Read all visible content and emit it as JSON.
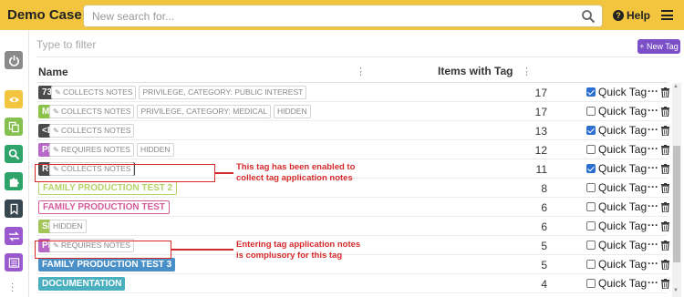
{
  "app": {
    "title": "Demo Case"
  },
  "search": {
    "placeholder": "New search for...",
    "icon": "search-icon"
  },
  "header": {
    "help_label": "Help",
    "menu_icon": "hamburger-menu-icon"
  },
  "sidebar": {
    "items": [
      {
        "icon": "power-icon",
        "color": "#8a8a8a"
      },
      {
        "icon": "eye-icon",
        "color": "#f3c43d"
      },
      {
        "icon": "copy-icon",
        "color": "#86c150"
      },
      {
        "icon": "search-icon",
        "color": "#2ea36a"
      },
      {
        "icon": "puzzle-icon",
        "color": "#2ea36a"
      },
      {
        "icon": "bookmark-icon",
        "color": "#37474f"
      },
      {
        "icon": "transfer-icon",
        "color": "#9b59d0"
      },
      {
        "icon": "list-icon",
        "color": "#9b59d0"
      }
    ]
  },
  "toolbar": {
    "filter_placeholder": "Type to filter",
    "new_tag_label": "+ New Tag"
  },
  "columns": {
    "name": "Name",
    "items_with_tag": "Items with Tag"
  },
  "rows": [
    {
      "tag": "734 MEYERS",
      "tag_suffix": "PI",
      "color": "#4a4a4a",
      "style": "solid",
      "chips": [
        {
          "text": "COLLECTS NOTES",
          "pen": true
        },
        {
          "text": "PRIVILEGE, CATEGORY: PUBLIC INTEREST",
          "pen": false
        }
      ],
      "count": "17",
      "quick_tag": true,
      "quick_tag_label": "Quick Tag"
    },
    {
      "tag": "MEDICAL A...",
      "color": "#8bc34a",
      "style": "solid",
      "chips": [
        {
          "text": "COLLECTS NOTES",
          "pen": true
        },
        {
          "text": "PRIVILEGE, CATEGORY: MEDICAL",
          "pen": false
        },
        {
          "text": "HIDDEN",
          "pen": false
        }
      ],
      "count": "17",
      "quick_tag": false,
      "quick_tag_label": "Quick Tag"
    },
    {
      "tag": "<PRIVILEGED TAG>",
      "color": "#4a4a4a",
      "style": "solid",
      "chips": [
        {
          "text": "COLLECTS NOTES",
          "pen": true
        }
      ],
      "count": "13",
      "quick_tag": true,
      "quick_tag_label": "Quick Tag"
    },
    {
      "tag": "PDF TEST",
      "color": "#b768c7",
      "style": "solid",
      "chips": [
        {
          "text": "REQUIRES NOTES",
          "pen": true
        },
        {
          "text": "HIDDEN",
          "pen": false
        }
      ],
      "count": "12",
      "quick_tag": false,
      "quick_tag_label": "Quick Tag"
    },
    {
      "tag": "REDACT FOR DEMO",
      "color": "#4a4a4a",
      "style": "solid",
      "chips": [
        {
          "text": "COLLECTS NOTES",
          "pen": true
        }
      ],
      "count": "11",
      "quick_tag": true,
      "quick_tag_label": "Quick Tag"
    },
    {
      "tag": "FAMILY PRODUCTION TEST 2",
      "color": "#b5d36a",
      "style": "outline",
      "chips": [],
      "count": "8",
      "quick_tag": false,
      "quick_tag_label": "Quick Tag"
    },
    {
      "tag": "FAMILY PRODUCTION TEST",
      "color": "#d45a9a",
      "style": "outline",
      "chips": [],
      "count": "6",
      "quick_tag": false,
      "quick_tag_label": "Quick Tag"
    },
    {
      "tag": "SET 8",
      "color": "#a3c65a",
      "style": "solid",
      "chips": [
        {
          "text": "HIDDEN",
          "pen": false
        }
      ],
      "count": "6",
      "quick_tag": false,
      "quick_tag_label": "Quick Tag"
    },
    {
      "tag": "PRIORITY",
      "color": "#b768c7",
      "style": "solid",
      "chips": [
        {
          "text": "REQUIRES NOTES",
          "pen": true
        }
      ],
      "count": "5",
      "quick_tag": false,
      "quick_tag_label": "Quick Tag"
    },
    {
      "tag": "FAMILY PRODUCTION TEST 3",
      "color": "#4a90c8",
      "style": "solid",
      "chips": [],
      "count": "5",
      "quick_tag": false,
      "quick_tag_label": "Quick Tag"
    },
    {
      "tag": "DOCUMENTATION",
      "color": "#4ab0c0",
      "style": "solid",
      "chips": [],
      "count": "4",
      "quick_tag": false,
      "quick_tag_label": "Quick Tag"
    }
  ],
  "annotations": [
    {
      "text_line1": "This tag has been enabled to",
      "text_line2": "collect tag application notes"
    },
    {
      "text_line1": "Entering tag application notes",
      "text_line2": "is complusory for this tag"
    }
  ]
}
